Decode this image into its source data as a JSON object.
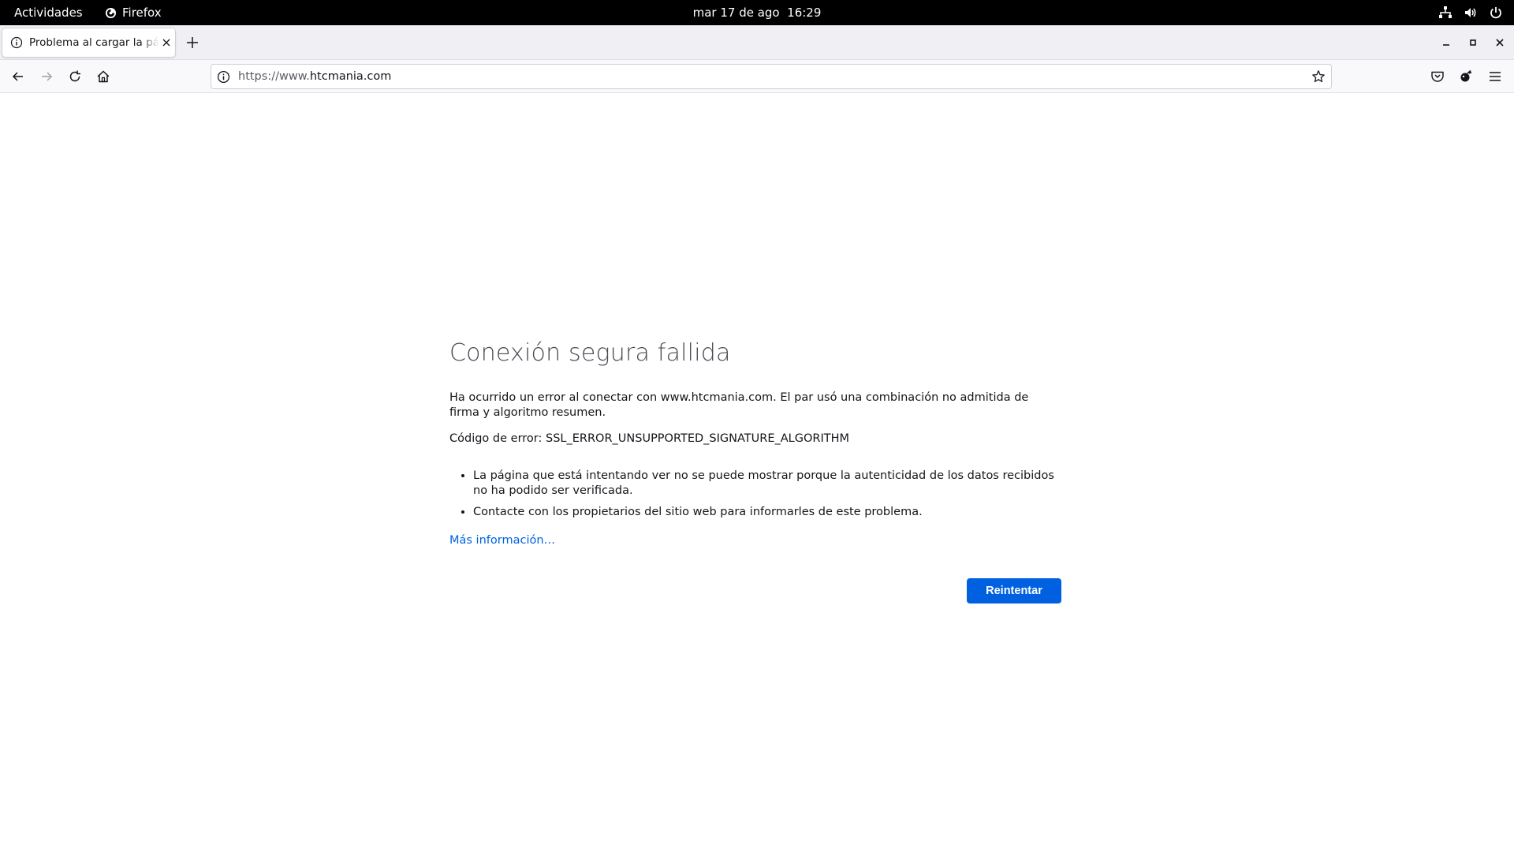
{
  "system_bar": {
    "activities": "Actividades",
    "app_name": "Firefox",
    "date": "mar 17 de ago",
    "time": "16:29"
  },
  "tab": {
    "title": "Problema al cargar la página"
  },
  "address_bar": {
    "url_prefix": "https://www.",
    "url_domain": "htcmania.com"
  },
  "error_page": {
    "title": "Conexión segura fallida",
    "description": "Ha ocurrido un error al conectar con www.htcmania.com. El par usó una combinación no admitida de firma y algoritmo resumen.",
    "error_code_label": "Código de error: ",
    "error_code": "SSL_ERROR_UNSUPPORTED_SIGNATURE_ALGORITHM",
    "bullets": [
      "La página que está intentando ver no se puede mostrar porque la autenticidad de los datos recibidos no ha podido ser verificada.",
      "Contacte con los propietarios del sitio web para informarles de este problema."
    ],
    "more_info_link": "Más información…",
    "retry_button": "Reintentar"
  },
  "colors": {
    "accent": "#0061e0",
    "topbar": "#000000",
    "tabstrip": "#f0f0f4",
    "navbar": "#f9f9fb"
  }
}
